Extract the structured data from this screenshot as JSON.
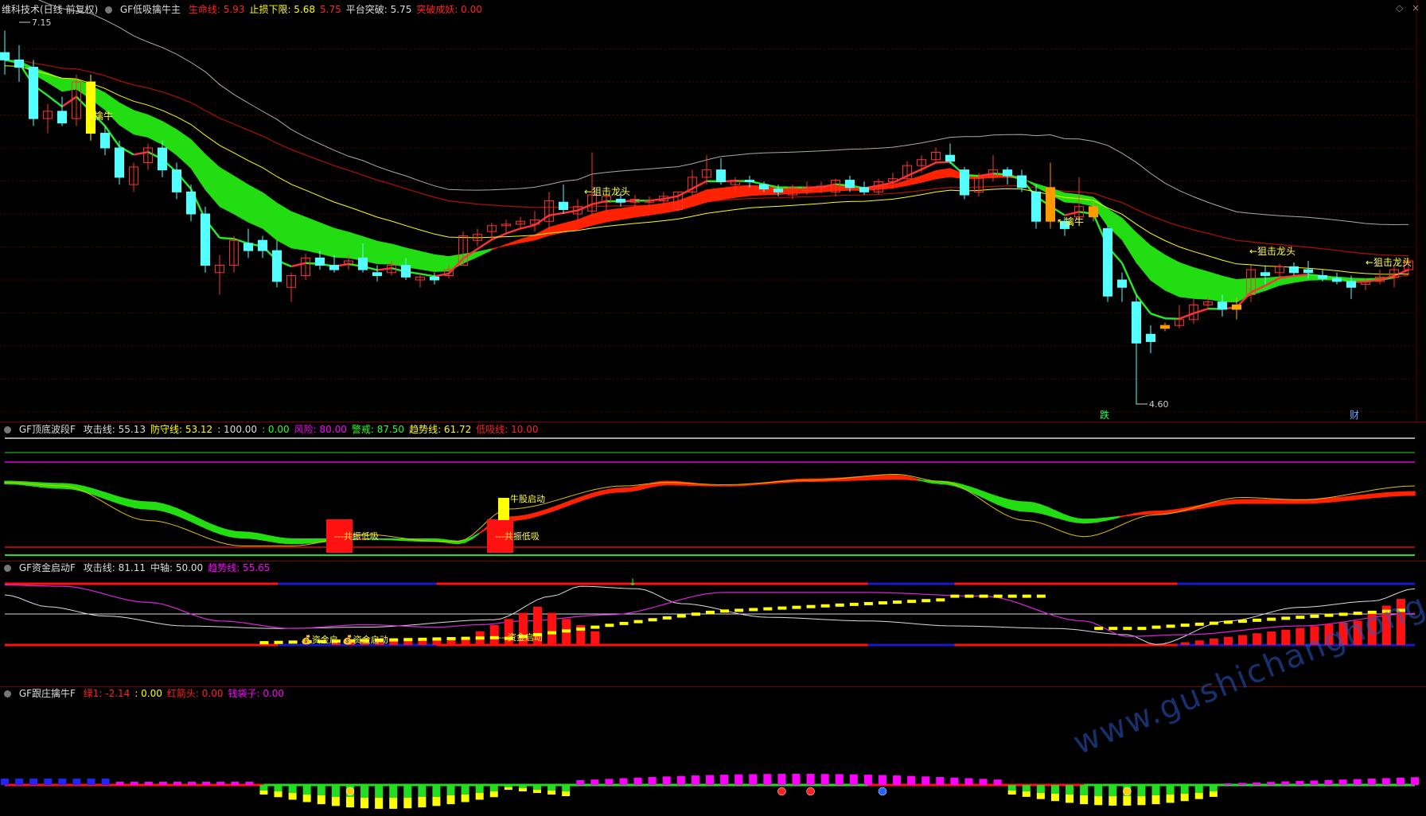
{
  "colors": {
    "background": "#000000",
    "grid": "#5a0000",
    "up_candle": "#ff3333",
    "down_candle": "#55ffff",
    "green_band": "#22dd11",
    "red_band": "#ff2200",
    "yellow": "#ffff00",
    "orange": "#ff9900",
    "magenta": "#ff00ff",
    "white": "#e6e6e6",
    "blue": "#2222cc"
  },
  "icons": {
    "settings": "circle-dot-icon",
    "diamond": "diamond-icon",
    "close": "close-icon"
  },
  "main_pane": {
    "title": "维科技术(日线 前复权)",
    "indicator": "GF低吸擒牛主",
    "fields": [
      {
        "label": "生命线:",
        "value": "5.93",
        "color": "#ff2222"
      },
      {
        "label": "止损下限:",
        "value": "5.68",
        "color": "#ffff00"
      },
      {
        "label": "",
        "value": "5.75",
        "color": "#ff2222"
      },
      {
        "label": "平台突破:",
        "value": "5.75",
        "color": "#dddddd"
      },
      {
        "label": "突破成妖:",
        "value": "0.00",
        "color": "#ff2222"
      }
    ],
    "high_label": "7.15",
    "low_label": "4.60",
    "annotations": [
      "擒牛",
      "狙击龙头",
      "擒牛",
      "狙击龙头",
      "狙击龙头"
    ],
    "bottom_markers": [
      "跌",
      "财"
    ]
  },
  "pane2": {
    "indicator": "GF顶底波段F",
    "fields": [
      {
        "label": "攻击线:",
        "value": "55.13",
        "color": "#dddddd"
      },
      {
        "label": "防守线:",
        "value": "53.12",
        "color": "#ffff00"
      },
      {
        "label": ":",
        "value": "100.00",
        "color": "#dddddd"
      },
      {
        "label": ":",
        "value": "0.00",
        "color": "#22ff22"
      },
      {
        "label": "风险:",
        "value": "80.00",
        "color": "#ff00ff"
      },
      {
        "label": "警戒:",
        "value": "87.50",
        "color": "#22ff22"
      },
      {
        "label": "趋势线:",
        "value": "61.72",
        "color": "#ffff00"
      },
      {
        "label": "低吸线:",
        "value": "10.00",
        "color": "#ff2222"
      }
    ],
    "annotations": [
      "共振低吸",
      "牛股启动",
      "共振低吸"
    ]
  },
  "pane3": {
    "indicator": "GF资金启动F",
    "fields": [
      {
        "label": "攻击线:",
        "value": "81.11",
        "color": "#dddddd"
      },
      {
        "label": "中轴:",
        "value": "50.00",
        "color": "#dddddd"
      },
      {
        "label": "趋势线:",
        "value": "55.65",
        "color": "#ff00ff"
      }
    ],
    "annotations": [
      "资金启",
      "资金启动",
      "资金启动"
    ]
  },
  "pane4": {
    "indicator": "GF跟庄擒牛F",
    "fields": [
      {
        "label": "绿1:",
        "value": "-2.14",
        "color": "#ff2222"
      },
      {
        "label": ":",
        "value": "0.00",
        "color": "#ffff00"
      },
      {
        "label": "红箭头:",
        "value": "0.00",
        "color": "#ff2222"
      },
      {
        "label": "钱袋子:",
        "value": "0.00",
        "color": "#ff00ff"
      }
    ]
  },
  "watermark": "www.gushichanghong.com",
  "chart_data": [
    {
      "type": "candlestick",
      "title": "维科技术(日线 前复权)",
      "ylim": [
        4.55,
        7.25
      ],
      "ohlc": [
        [
          7.0,
          7.15,
          6.85,
          6.95
        ],
        [
          6.95,
          7.05,
          6.8,
          6.9
        ],
        [
          6.9,
          6.95,
          6.5,
          6.55
        ],
        [
          6.55,
          6.65,
          6.45,
          6.6
        ],
        [
          6.6,
          6.7,
          6.5,
          6.52
        ],
        [
          6.55,
          6.85,
          6.5,
          6.8
        ],
        [
          6.8,
          6.85,
          6.4,
          6.45
        ],
        [
          6.45,
          6.5,
          6.3,
          6.35
        ],
        [
          6.35,
          6.4,
          6.1,
          6.15
        ],
        [
          6.1,
          6.25,
          6.05,
          6.22
        ],
        [
          6.25,
          6.38,
          6.2,
          6.35
        ],
        [
          6.35,
          6.4,
          6.15,
          6.2
        ],
        [
          6.2,
          6.25,
          6.0,
          6.05
        ],
        [
          6.05,
          6.1,
          5.85,
          5.9
        ],
        [
          5.9,
          5.95,
          5.5,
          5.55
        ],
        [
          5.5,
          5.62,
          5.35,
          5.55
        ],
        [
          5.55,
          5.75,
          5.5,
          5.72
        ],
        [
          5.7,
          5.8,
          5.6,
          5.65
        ],
        [
          5.72,
          5.75,
          5.6,
          5.65
        ],
        [
          5.65,
          5.72,
          5.4,
          5.44
        ],
        [
          5.4,
          5.5,
          5.3,
          5.48
        ],
        [
          5.48,
          5.63,
          5.45,
          5.6
        ],
        [
          5.6,
          5.65,
          5.52,
          5.55
        ],
        [
          5.55,
          5.62,
          5.5,
          5.52
        ],
        [
          5.56,
          5.62,
          5.52,
          5.58
        ],
        [
          5.6,
          5.7,
          5.5,
          5.52
        ],
        [
          5.5,
          5.55,
          5.44,
          5.48
        ],
        [
          5.5,
          5.58,
          5.48,
          5.55
        ],
        [
          5.55,
          5.6,
          5.45,
          5.47
        ],
        [
          5.45,
          5.5,
          5.4,
          5.47
        ],
        [
          5.47,
          5.5,
          5.42,
          5.45
        ],
        [
          5.48,
          5.55,
          5.46,
          5.52
        ],
        [
          5.55,
          5.78,
          5.55,
          5.75
        ],
        [
          5.72,
          5.8,
          5.68,
          5.76
        ],
        [
          5.78,
          5.84,
          5.72,
          5.82
        ],
        [
          5.82,
          5.86,
          5.76,
          5.83
        ],
        [
          5.83,
          5.88,
          5.8,
          5.85
        ],
        [
          5.83,
          5.92,
          5.78,
          5.86
        ],
        [
          5.85,
          6.05,
          5.8,
          5.99
        ],
        [
          5.98,
          6.1,
          5.9,
          5.93
        ],
        [
          5.9,
          6.0,
          5.85,
          5.95
        ],
        [
          5.92,
          6.32,
          5.88,
          6.03
        ],
        [
          5.98,
          6.05,
          5.92,
          6.02
        ],
        [
          6.0,
          6.05,
          5.95,
          5.98
        ],
        [
          5.98,
          6.03,
          5.94,
          6.0
        ],
        [
          5.98,
          6.02,
          5.94,
          5.99
        ],
        [
          5.99,
          6.05,
          5.96,
          6.02
        ],
        [
          5.93,
          6.05,
          5.92,
          6.05
        ],
        [
          6.05,
          6.2,
          6.02,
          6.15
        ],
        [
          6.15,
          6.3,
          6.1,
          6.2
        ],
        [
          6.2,
          6.28,
          6.1,
          6.12
        ],
        [
          6.1,
          6.15,
          6.05,
          6.13
        ],
        [
          6.13,
          6.16,
          6.08,
          6.12
        ],
        [
          6.1,
          6.12,
          6.05,
          6.07
        ],
        [
          6.07,
          6.1,
          6.02,
          6.05
        ],
        [
          6.03,
          6.1,
          6.0,
          6.08
        ],
        [
          6.06,
          6.12,
          6.03,
          6.08
        ],
        [
          6.08,
          6.12,
          6.04,
          6.09
        ],
        [
          6.05,
          6.14,
          6.02,
          6.13
        ],
        [
          6.13,
          6.16,
          6.05,
          6.08
        ],
        [
          6.08,
          6.12,
          6.03,
          6.05
        ],
        [
          6.05,
          6.14,
          6.03,
          6.12
        ],
        [
          6.12,
          6.18,
          6.08,
          6.14
        ],
        [
          6.14,
          6.26,
          6.12,
          6.23
        ],
        [
          6.23,
          6.3,
          6.18,
          6.27
        ],
        [
          6.27,
          6.35,
          6.24,
          6.32
        ],
        [
          6.3,
          6.38,
          6.24,
          6.26
        ],
        [
          6.2,
          6.22,
          6.0,
          6.03
        ],
        [
          6.05,
          6.18,
          6.02,
          6.15
        ],
        [
          6.15,
          6.3,
          6.12,
          6.2
        ],
        [
          6.2,
          6.22,
          6.1,
          6.16
        ],
        [
          6.16,
          6.2,
          6.05,
          6.08
        ],
        [
          6.05,
          6.1,
          5.8,
          5.85
        ],
        [
          6.08,
          6.25,
          5.8,
          5.85
        ],
        [
          5.85,
          5.88,
          5.75,
          5.8
        ],
        [
          5.88,
          6.15,
          5.82,
          5.95
        ],
        [
          5.95,
          5.98,
          5.85,
          5.88
        ],
        [
          5.8,
          5.82,
          5.3,
          5.34
        ],
        [
          5.45,
          5.5,
          5.3,
          5.4
        ],
        [
          5.3,
          5.35,
          4.6,
          5.02
        ],
        [
          5.08,
          5.14,
          4.95,
          5.03
        ],
        [
          5.12,
          5.16,
          5.1,
          5.14
        ],
        [
          5.14,
          5.28,
          5.12,
          5.18
        ],
        [
          5.18,
          5.32,
          5.15,
          5.28
        ],
        [
          5.28,
          5.33,
          5.25,
          5.3
        ],
        [
          5.3,
          5.35,
          5.2,
          5.25
        ],
        [
          5.25,
          5.33,
          5.18,
          5.28
        ],
        [
          5.35,
          5.55,
          5.3,
          5.52
        ],
        [
          5.5,
          5.55,
          5.42,
          5.48
        ],
        [
          5.5,
          5.56,
          5.46,
          5.54
        ],
        [
          5.54,
          5.57,
          5.48,
          5.5
        ],
        [
          5.52,
          5.58,
          5.46,
          5.5
        ],
        [
          5.48,
          5.52,
          5.44,
          5.46
        ],
        [
          5.46,
          5.5,
          5.42,
          5.44
        ],
        [
          5.44,
          5.48,
          5.32,
          5.4
        ],
        [
          5.42,
          5.46,
          5.38,
          5.44
        ],
        [
          5.44,
          5.52,
          5.42,
          5.47
        ],
        [
          5.47,
          5.55,
          5.4,
          5.52
        ],
        [
          5.52,
          5.6,
          5.48,
          5.58
        ]
      ],
      "series": [
        {
          "name": "生命线",
          "color": "#cc1100"
        },
        {
          "name": "止损下限",
          "color": "#ffff00"
        }
      ]
    },
    {
      "type": "line",
      "title": "GF顶底波段F",
      "ylim": [
        0,
        100
      ]
    },
    {
      "type": "bar",
      "title": "GF资金启动F",
      "ylim": [
        0,
        100
      ]
    },
    {
      "type": "bar",
      "title": "GF跟庄擒牛F"
    }
  ]
}
